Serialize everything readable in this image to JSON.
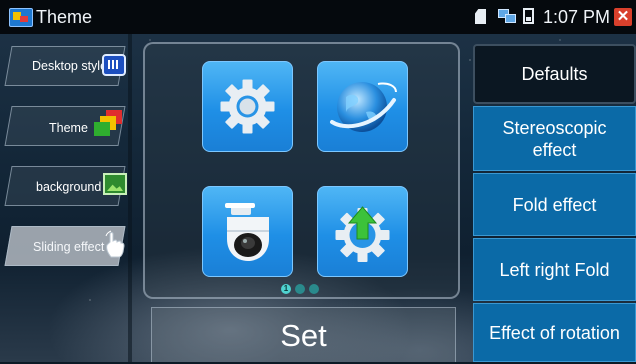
{
  "statusbar": {
    "app_title": "Theme",
    "time": "1:07 PM",
    "icons": [
      "app-theme-icon",
      "sd-card-icon",
      "network-icon",
      "battery-icon",
      "close-icon"
    ],
    "close_glyph": "✕"
  },
  "left_menu": {
    "items": [
      {
        "label": "Desktop style",
        "icon": "desktop-style-icon"
      },
      {
        "label": "Theme",
        "icon": "theme-squares-icon"
      },
      {
        "label": "background",
        "icon": "background-image-icon"
      },
      {
        "label": "Sliding effect",
        "icon": "hand-swipe-icon",
        "active": true
      }
    ]
  },
  "center": {
    "tiles": [
      {
        "icon": "gear-icon"
      },
      {
        "icon": "globe-icon"
      },
      {
        "icon": "ptz-camera-icon"
      },
      {
        "icon": "update-gear-icon"
      }
    ],
    "page_indicator": {
      "current": "1",
      "total": 3
    },
    "set_label": "Set"
  },
  "right_menu": {
    "items": [
      {
        "label": "Defaults"
      },
      {
        "label": "Stereoscopic effect"
      },
      {
        "label": "Fold effect"
      },
      {
        "label": "Left right Fold"
      },
      {
        "label": "Effect of rotation"
      }
    ]
  },
  "colors": {
    "accent_blue": "#1f8fe6",
    "right_item_bg": "#0b6aa7",
    "close_red": "#d9402c"
  }
}
